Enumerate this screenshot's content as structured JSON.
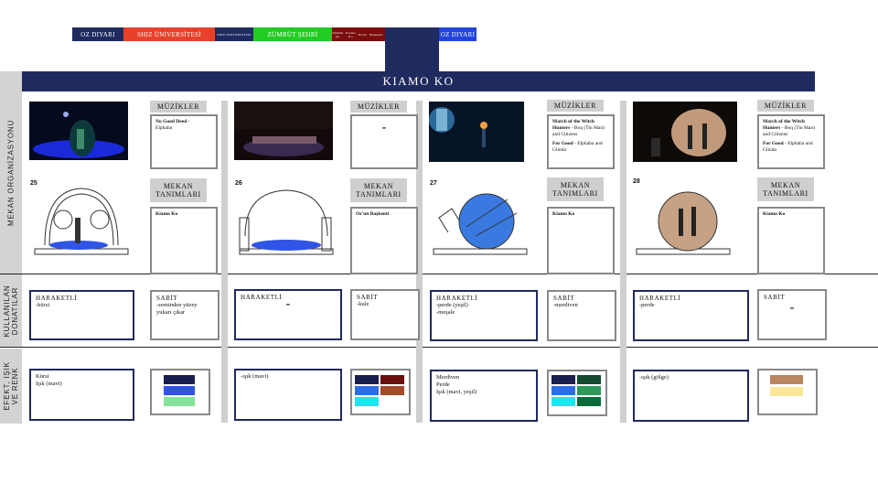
{
  "nav": [
    {
      "label": "OZ DIYARI",
      "color": "#1f2a5e"
    },
    {
      "label": "SHIZ ÜNİVERSİTESİ",
      "color": "#e8412a"
    },
    {
      "label": "SHIZ ÜNİVERSİTESİ",
      "color": "#1f2a5e"
    },
    {
      "label": "ZÜMRÜT ŞEHRİ",
      "color": "#22cc22"
    },
    {
      "label": "Zümrüt Şe.",
      "color": "#7a0d0d"
    },
    {
      "label": "Kiamo Ko",
      "color": "#7a0d0d"
    },
    {
      "label": "Oz'un",
      "color": "#7a0d0d"
    },
    {
      "label": "Başkenti",
      "color": "#7a0d0d"
    },
    {
      "label": "OZ DIYARI",
      "color": "#2244dd"
    }
  ],
  "title": "KIAMO KO",
  "side_labels": {
    "mekan": "MEKAN ORGANİZASYONU",
    "donatilar_1": "KULLANILAN",
    "donatilar_2": "DONATILAR",
    "efekt_1": "EFEKT, IŞIK",
    "efekt_2": "VE RENK"
  },
  "labels": {
    "muzikler": "MÜZİKLER",
    "mekan_1": "MEKAN",
    "mekan_2": "TANIMLARI",
    "hareketli": "HARAKETLİ",
    "sabit": "SABİT"
  },
  "scenes": [
    {
      "number": "25",
      "music": [
        {
          "title": "No Good Deed -",
          "by": "Elphaba"
        }
      ],
      "music_dash": "",
      "mekan": "Kiamo Ko",
      "hareketli": "-kürsi",
      "hareketli_dash": "",
      "sabit": "-zeminden yüzey yukarı çıkar",
      "sabit_dash": "",
      "efekt": [
        "Kürsi",
        "Işık (mavi)"
      ],
      "colors": [
        "#1b1f4f",
        "#2f54e6",
        "#86e29a"
      ]
    },
    {
      "number": "26",
      "music": [],
      "music_dash": "-",
      "mekan": "Oz'un Başkenti",
      "hareketli": "",
      "hareketli_dash": "-",
      "sabit": "-kule",
      "sabit_dash": "",
      "efekt": [
        "-ışık (mavi)"
      ],
      "colors": [
        "#1b1f4f",
        "#6a1010",
        "#2f6de6",
        "#a24a2a",
        "#21e3f0"
      ]
    },
    {
      "number": "27",
      "music": [
        {
          "title": "March of the Witch Hunters",
          "by": "- Boq (Tin Man) and Citizens"
        },
        {
          "title": "For Good",
          "by": "- Elphaba and Glinda"
        }
      ],
      "music_dash": "",
      "mekan": "Kiamo Ko",
      "hareketli": "-perde (yeşil)\n-meşale",
      "hareketli_dash": "",
      "sabit": "-merdiven",
      "sabit_dash": "",
      "efekt": [
        "Merdiven",
        "Perde",
        "Işık (mavi, yeşil)"
      ],
      "colors": [
        "#1b1f4f",
        "#134a30",
        "#2f6de6",
        "#2c9a5a",
        "#21e3f0",
        "#0d6b3a"
      ]
    },
    {
      "number": "28",
      "music": [
        {
          "title": "March of the Witch Hunters",
          "by": "- Boq (Tin Man) and Citizens"
        },
        {
          "title": "For Good",
          "by": "- Elphaba and Glinda"
        }
      ],
      "music_dash": "",
      "mekan": "Kiamo Ko",
      "hareketli": "-perde",
      "hareketli_dash": "",
      "sabit": "",
      "sabit_dash": "-",
      "efekt": [
        "-ışık (gölge)"
      ],
      "colors": [
        "#b98661",
        "#fbe79a"
      ]
    }
  ]
}
